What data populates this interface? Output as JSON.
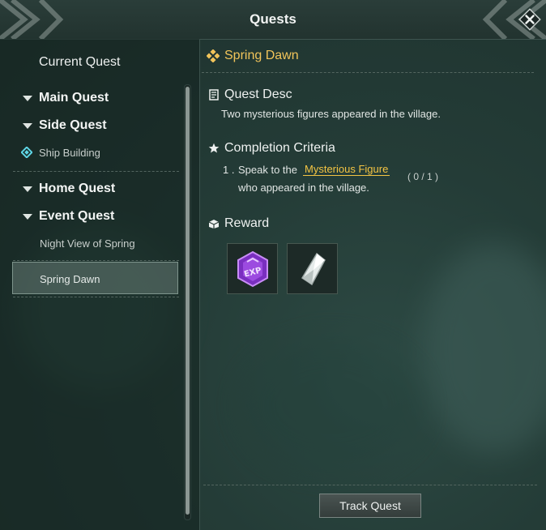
{
  "window": {
    "title": "Quests"
  },
  "sidebar": {
    "current_label": "Current Quest",
    "categories": [
      {
        "label": "Main Quest"
      },
      {
        "label": "Side Quest",
        "items": [
          "Ship Building"
        ]
      },
      {
        "label": "Home Quest"
      },
      {
        "label": "Event Quest",
        "items": [
          "Night View of Spring",
          "Spring Dawn"
        ]
      }
    ],
    "selected_item": "Spring Dawn"
  },
  "quest": {
    "title": "Spring Dawn",
    "desc_heading": "Quest Desc",
    "desc_text": "Two mysterious figures appeared in the village.",
    "criteria_heading": "Completion Criteria",
    "criteria": {
      "number": "1 .",
      "before": "Speak to the",
      "highlight": "Mysterious Figure",
      "progress": "( 0 / 1 )",
      "after": "who appeared in the village."
    },
    "reward_heading": "Reward",
    "rewards": [
      "exp-crystal-icon",
      "silver-shard-icon"
    ]
  },
  "footer": {
    "track_label": "Track Quest"
  },
  "colors": {
    "accent": "#f1c45a",
    "highlight": "#f3c443",
    "selected_bg": "#6f8680"
  }
}
